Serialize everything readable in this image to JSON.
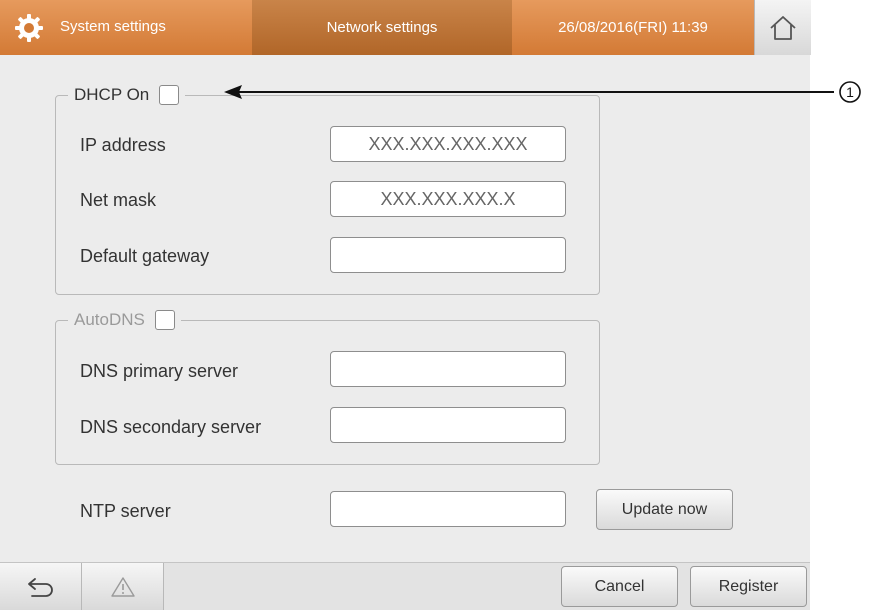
{
  "header": {
    "title": "System settings",
    "active_tab": "Network settings",
    "datetime": "26/08/2016(FRI) 11:39",
    "icons": {
      "settings": "gear-icon",
      "home": "home-icon"
    }
  },
  "dhcp": {
    "legend": "DHCP On",
    "checked": false,
    "fields": [
      {
        "label": "IP address",
        "value": "XXX.XXX.XXX.XXX"
      },
      {
        "label": "Net mask",
        "value": "XXX.XXX.XXX.X"
      },
      {
        "label": "Default gateway",
        "value": ""
      }
    ]
  },
  "dns": {
    "legend": "AutoDNS",
    "checked": false,
    "fields": [
      {
        "label": "DNS primary server",
        "value": ""
      },
      {
        "label": "DNS secondary server",
        "value": ""
      }
    ]
  },
  "ntp": {
    "label": "NTP server",
    "value": "",
    "update_label": "Update now"
  },
  "footer": {
    "back_icon": "back-arrow-icon",
    "warning_icon": "warning-icon",
    "cancel_label": "Cancel",
    "register_label": "Register"
  },
  "annotation": {
    "number": "①"
  },
  "colors": {
    "header_orange": "#d37a35",
    "header_active": "#b16628",
    "background": "#ececec"
  }
}
